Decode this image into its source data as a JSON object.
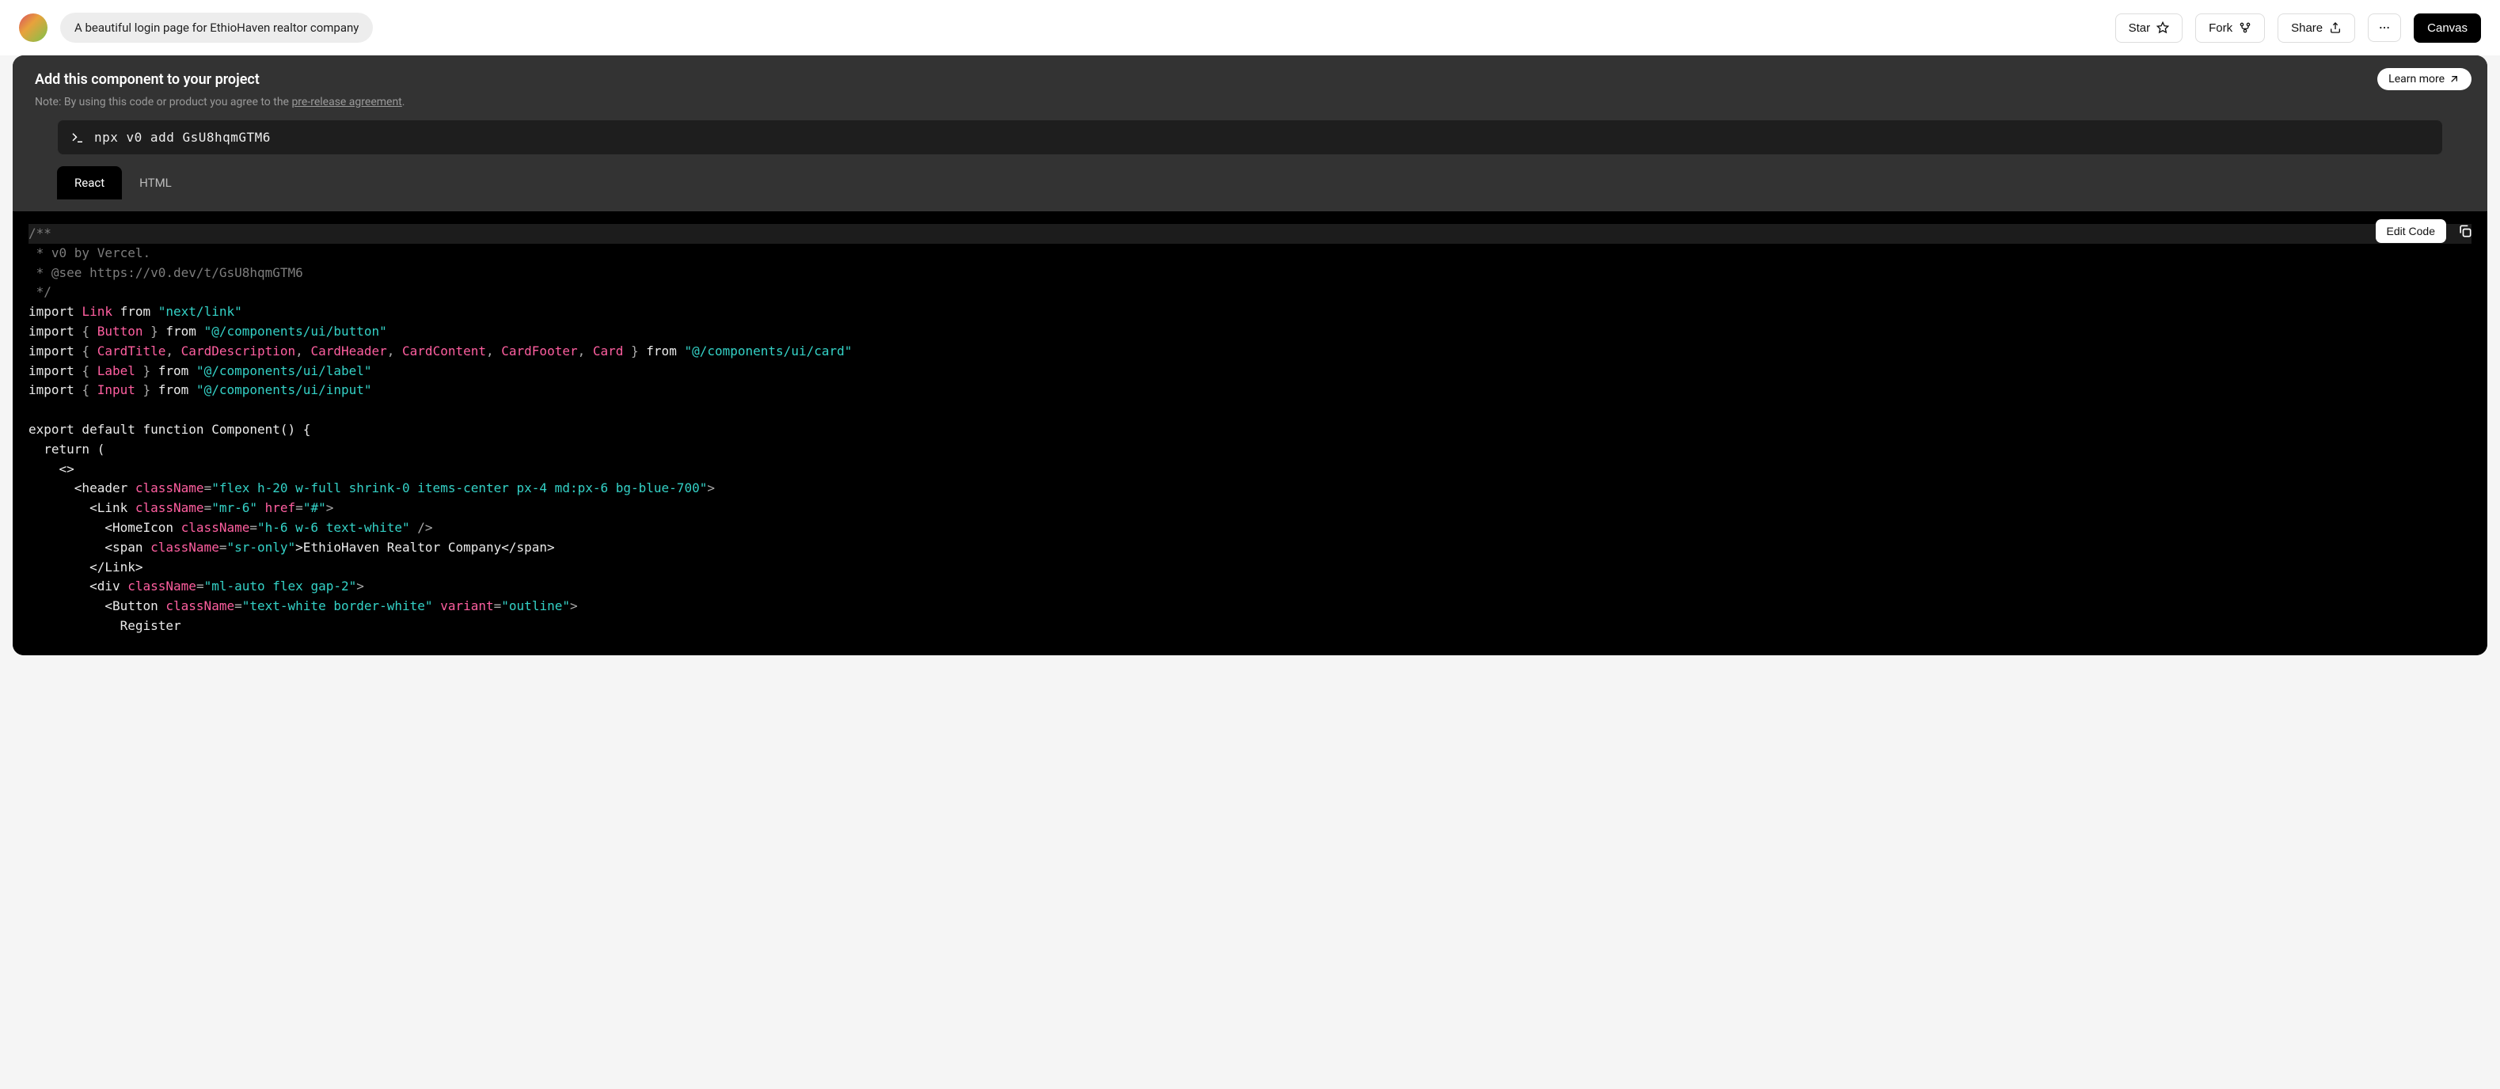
{
  "topbar": {
    "prompt": "A beautiful login page for EthioHaven realtor company",
    "star": "Star",
    "fork": "Fork",
    "share": "Share",
    "canvas": "Canvas"
  },
  "banner": {
    "title": "Add this component to your project",
    "note_prefix": "Note:",
    "note_body": "By using this code or product you agree to the ",
    "note_link": "pre-release agreement",
    "learn_more": "Learn more"
  },
  "command": {
    "text": "npx v0 add GsU8hqmGTM6"
  },
  "tabs": {
    "react": "React",
    "html": "HTML"
  },
  "code_panel": {
    "edit_code": "Edit Code"
  },
  "code": {
    "c1": "/**",
    "c2": " * v0 by Vercel.",
    "c3": " * @see https://v0.dev/t/GsU8hqmGTM6",
    "c4": " */",
    "imp_link_kw": "import ",
    "imp_link_id": "Link",
    "imp_from": " from ",
    "imp_link_str": "\"next/link\"",
    "imp_button_id": "Button",
    "imp_button_str": "\"@/components/ui/button\"",
    "card_ids": [
      "CardTitle",
      "CardDescription",
      "CardHeader",
      "CardContent",
      "CardFooter",
      "Card"
    ],
    "imp_card_str": "\"@/components/ui/card\"",
    "imp_label_id": "Label",
    "imp_label_str": "\"@/components/ui/label\"",
    "imp_input_id": "Input",
    "imp_input_str": "\"@/components/ui/input\"",
    "fn_decl_pre": "export default function ",
    "fn_name": "Component",
    "fn_decl_post": "() {",
    "return_line": "  return (",
    "frag_open": "    <>",
    "header_open_pre": "      <header ",
    "className_attr": "className",
    "header_cls": "\"flex h-20 w-full shrink-0 items-center px-4 md:px-6 bg-blue-700\"",
    "link_open_pre": "        <Link ",
    "link_cls": "\"mr-6\"",
    "href_attr": "href",
    "link_href": "\"#\"",
    "homeicon_pre": "          <HomeIcon ",
    "homeicon_cls": "\"h-6 w-6 text-white\"",
    "span_pre": "          <span ",
    "span_cls": "\"sr-only\"",
    "span_text": ">EthioHaven Realtor Company</span>",
    "link_close": "        </Link>",
    "div_pre": "        <div ",
    "div_cls": "\"ml-auto flex gap-2\"",
    "button_pre": "          <Button ",
    "button_cls": "\"text-white border-white\"",
    "variant_attr": "variant",
    "button_variant": "\"outline\"",
    "register_text": "            Register"
  }
}
